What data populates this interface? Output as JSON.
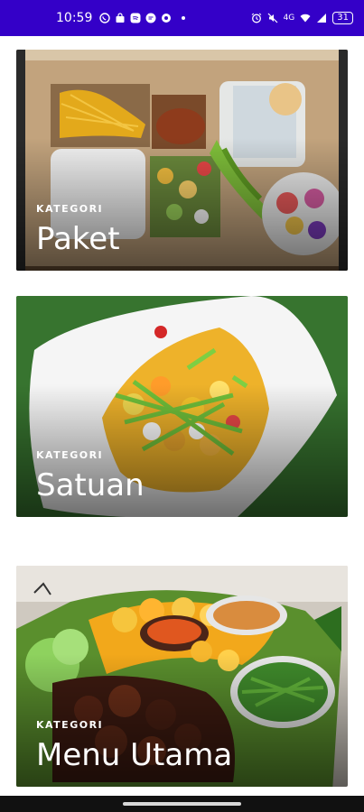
{
  "status_bar": {
    "time": "10:59",
    "network_text": "4G",
    "battery": "31",
    "bg_color": "#3400c8",
    "icons": [
      "whatsapp-icon",
      "shopping-bag-icon",
      "spotify-icon",
      "message-icon",
      "settings-icon",
      "alarm-icon",
      "mute-icon",
      "wifi-icon",
      "signal-icon",
      "battery-icon"
    ]
  },
  "categories": [
    {
      "label": "KATEGORI",
      "title": "Paket"
    },
    {
      "label": "KATEGORI",
      "title": "Satuan"
    },
    {
      "label": "KATEGORI",
      "title": "Menu Utama"
    }
  ]
}
